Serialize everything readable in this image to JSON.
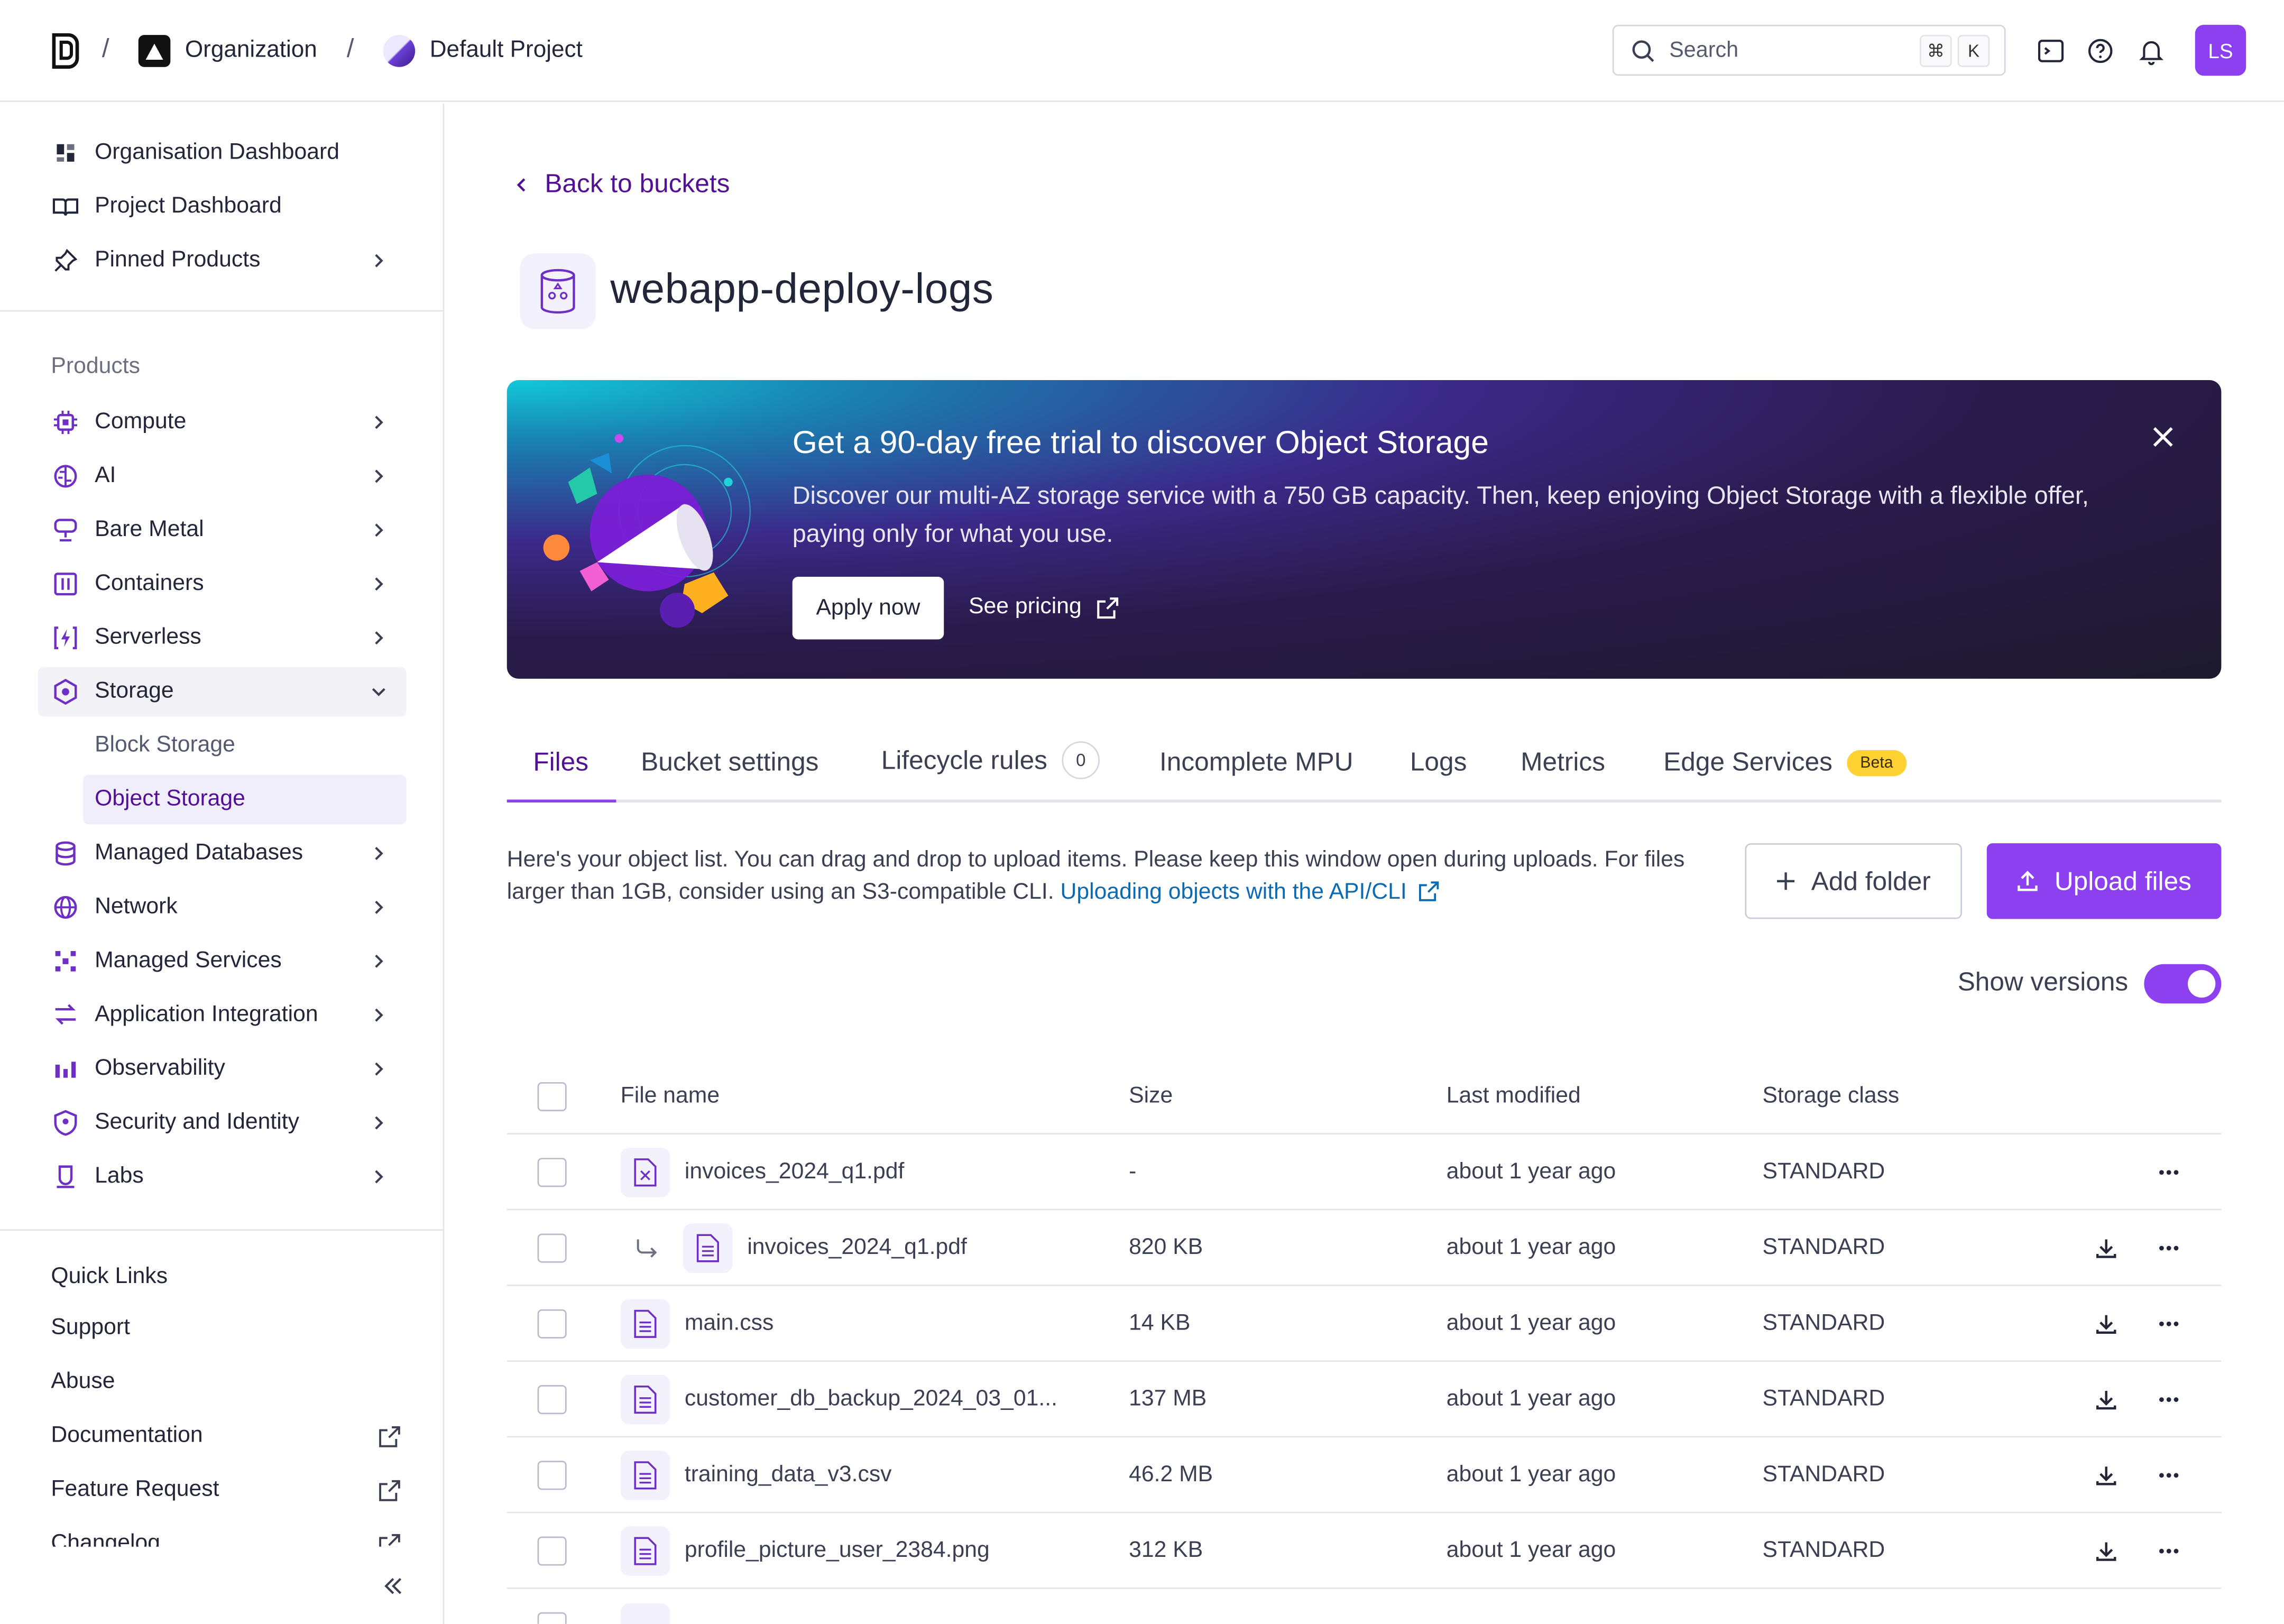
{
  "header": {
    "org": "Organization",
    "project": "Default Project",
    "search_placeholder": "Search",
    "kbd1": "⌘",
    "kbd2": "K",
    "avatar": "LS",
    "sep": "/"
  },
  "sidebar": {
    "top": [
      {
        "label": "Organisation Dashboard",
        "icon": "dashboard-icon"
      },
      {
        "label": "Project Dashboard",
        "icon": "book-icon"
      },
      {
        "label": "Pinned Products",
        "icon": "pin-icon"
      }
    ],
    "products_label": "Products",
    "products": [
      {
        "label": "Compute",
        "icon": "cpu-icon"
      },
      {
        "label": "AI",
        "icon": "brain-icon"
      },
      {
        "label": "Bare Metal",
        "icon": "server-icon"
      },
      {
        "label": "Containers",
        "icon": "container-icon"
      },
      {
        "label": "Serverless",
        "icon": "serverless-icon"
      },
      {
        "label": "Storage",
        "icon": "storage-icon"
      },
      {
        "label": "Managed Databases",
        "icon": "database-icon"
      },
      {
        "label": "Network",
        "icon": "globe-icon"
      },
      {
        "label": "Managed Services",
        "icon": "services-icon"
      },
      {
        "label": "Application Integration",
        "icon": "integration-icon"
      },
      {
        "label": "Observability",
        "icon": "bars-icon"
      },
      {
        "label": "Security and Identity",
        "icon": "shield-icon"
      },
      {
        "label": "Labs",
        "icon": "flask-icon"
      }
    ],
    "storage_sub": [
      "Block Storage",
      "Object Storage"
    ],
    "quick_links_label": "Quick Links",
    "quick_links": [
      {
        "label": "Support",
        "external": false
      },
      {
        "label": "Abuse",
        "external": false
      },
      {
        "label": "Documentation",
        "external": true
      },
      {
        "label": "Feature Request",
        "external": true
      },
      {
        "label": "Changelog",
        "external": true
      }
    ]
  },
  "main": {
    "back_label": "Back to buckets",
    "bucket_name": "webapp-deploy-logs",
    "banner": {
      "title": "Get a 90-day free trial to discover Object Storage",
      "desc": "Discover our multi-AZ storage service with a 750 GB capacity. Then, keep enjoying Object Storage with a flexible offer, paying only for what you use.",
      "apply": "Apply now",
      "pricing": "See pricing"
    },
    "tabs": [
      {
        "label": "Files"
      },
      {
        "label": "Bucket settings"
      },
      {
        "label": "Lifecycle rules",
        "count": "0"
      },
      {
        "label": "Incomplete MPU"
      },
      {
        "label": "Logs"
      },
      {
        "label": "Metrics"
      },
      {
        "label": "Edge Services",
        "badge": "Beta"
      }
    ],
    "intro_text": "Here's your object list. You can drag and drop to upload items. Please keep this window open during uploads. For files larger than 1GB, consider using an S3-compatible CLI.",
    "intro_link": "Uploading objects with the API/CLI",
    "add_folder": "Add folder",
    "upload_files": "Upload files",
    "show_versions": "Show versions",
    "versions_on": true,
    "columns": [
      "File name",
      "Size",
      "Last modified",
      "Storage class"
    ],
    "rows": [
      {
        "name": "invoices_2024_q1.pdf",
        "size": "-",
        "modified": "about 1 year ago",
        "class": "STANDARD",
        "deleted": true,
        "version": false
      },
      {
        "name": "invoices_2024_q1.pdf",
        "size": "820 KB",
        "modified": "about 1 year ago",
        "class": "STANDARD",
        "deleted": false,
        "version": true
      },
      {
        "name": "main.css",
        "size": "14 KB",
        "modified": "about 1 year ago",
        "class": "STANDARD",
        "deleted": false,
        "version": false
      },
      {
        "name": "customer_db_backup_2024_03_01...",
        "size": "137 MB",
        "modified": "about 1 year ago",
        "class": "STANDARD",
        "deleted": false,
        "version": false
      },
      {
        "name": "training_data_v3.csv",
        "size": "46.2 MB",
        "modified": "about 1 year ago",
        "class": "STANDARD",
        "deleted": false,
        "version": false
      },
      {
        "name": "profile_picture_user_2384.png",
        "size": "312 KB",
        "modified": "about 1 year ago",
        "class": "STANDARD",
        "deleted": false,
        "version": false
      }
    ]
  }
}
